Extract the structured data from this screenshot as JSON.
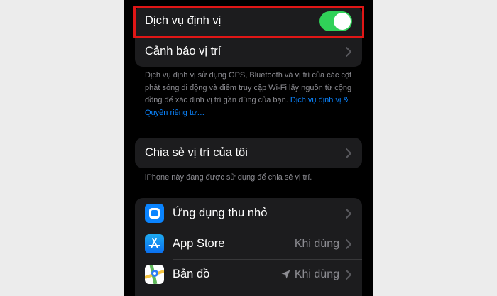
{
  "location_services": {
    "label": "Dịch vụ định vị",
    "enabled": true
  },
  "location_alerts": {
    "label": "Cảnh báo vị trí"
  },
  "description": {
    "text": "Dịch vụ định vị sử dụng GPS, Bluetooth và vị trí của các cột phát sóng di động và điểm truy cập Wi-Fi lấy nguồn từ cộng đồng để xác định vị trí gần đúng của bạn. ",
    "link": "Dịch vụ định vị & Quyền riêng tư…"
  },
  "share_location": {
    "label": "Chia sẻ vị trí của tôi",
    "footnote": "iPhone này đang được sử dụng để chia sẻ vị trí."
  },
  "apps": [
    {
      "label": "Ứng dụng thu nhỏ",
      "value": "",
      "icon": "widget-icon"
    },
    {
      "label": "App Store",
      "value": "Khi dùng",
      "icon": "app-store-icon"
    },
    {
      "label": "Bản đồ",
      "value": "Khi dùng",
      "icon": "maps-icon"
    }
  ],
  "colors": {
    "background": "#000000",
    "cell": "#1c1c1e",
    "toggle_on": "#30d158",
    "link": "#0a84ff",
    "highlight": "#e01616"
  }
}
